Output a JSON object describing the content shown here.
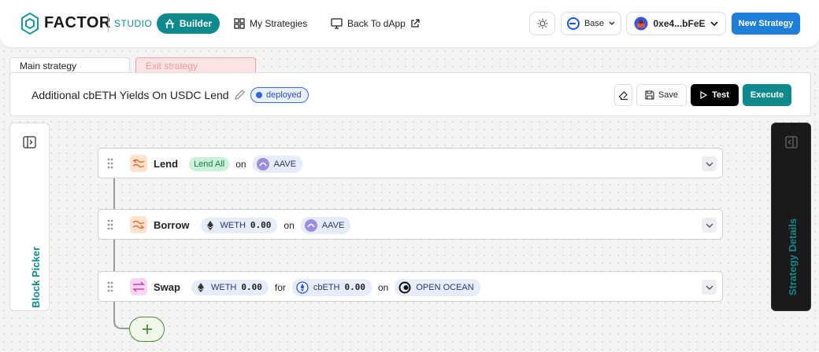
{
  "brand": {
    "name": "FACTOR",
    "product": "STUDIO"
  },
  "nav": {
    "builder": "Builder",
    "my_strategies": "My Strategies",
    "back_to_dapp": "Back To dApp",
    "chain": "Base",
    "wallet": "0xe4...bFeE",
    "new_strategy": "New Strategy"
  },
  "tabs": {
    "main": "Main strategy",
    "exit": "Exit strategy"
  },
  "strategy": {
    "title": "Additional cbETH Yields On USDC Lend",
    "status": "deployed",
    "actions": {
      "save": "Save",
      "test": "Test",
      "execute": "Execute"
    }
  },
  "panels": {
    "left": "Block Picker",
    "right": "Strategy Details"
  },
  "blocks": [
    {
      "name": "Lend",
      "mode": "Lend All",
      "on": "on",
      "protocol": "AAVE"
    },
    {
      "name": "Borrow",
      "token": "WETH",
      "amount": "0.00",
      "on": "on",
      "protocol": "AAVE"
    },
    {
      "name": "Swap",
      "from_token": "WETH",
      "from_amount": "0.00",
      "for": "for",
      "to_token": "cbETH",
      "to_amount": "0.00",
      "on": "on",
      "protocol": "OPEN OCEAN"
    }
  ],
  "colors": {
    "accent": "#0e8a8f",
    "primary_blue": "#1e7fd8",
    "add_green": "#4f8a35"
  }
}
